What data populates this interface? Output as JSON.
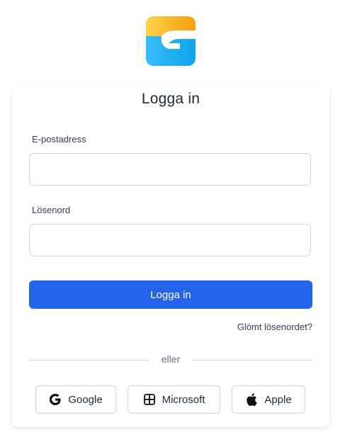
{
  "brand": {
    "logo_icon": "brand-g-logo-icon",
    "colors": {
      "top": "#f59e0b",
      "top_light": "#fcd34d",
      "bottom": "#0ea5e9",
      "bottom_light": "#38bdf8"
    }
  },
  "login": {
    "title": "Logga in",
    "email_label": "E-postadress",
    "email_value": "",
    "email_placeholder": "",
    "password_label": "Lösenord",
    "password_value": "",
    "password_placeholder": "",
    "submit_label": "Logga in",
    "forgot_label": "Glömt lösenordet?",
    "or_label": "eller",
    "accent_color": "#2563eb"
  },
  "social": [
    {
      "label": "Google",
      "icon": "google-g-icon"
    },
    {
      "label": "Microsoft",
      "icon": "microsoft-grid-icon"
    },
    {
      "label": "Apple",
      "icon": "apple-icon"
    }
  ]
}
